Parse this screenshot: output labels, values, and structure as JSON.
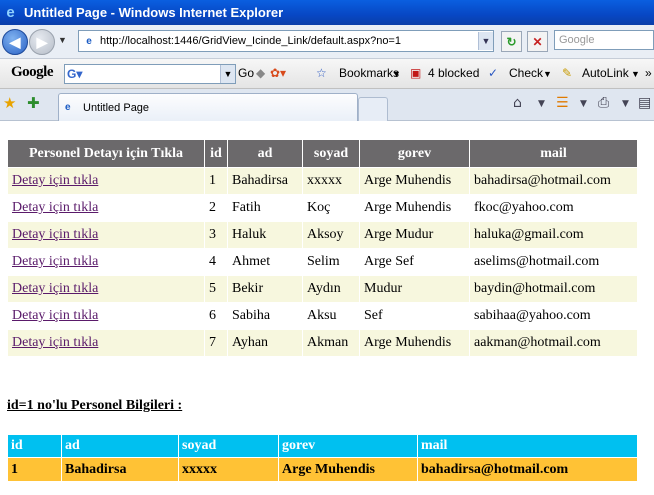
{
  "window": {
    "title": "Untitled Page - Windows Internet Explorer"
  },
  "address_bar": {
    "url": "http://localhost:1446/GridView_Icinde_Link/default.aspx?no=1"
  },
  "search_box": {
    "placeholder": "Google"
  },
  "google_toolbar": {
    "logo": "Google",
    "go_label": "Go",
    "bookmarks_label": "Bookmarks",
    "blocked_label": "4 blocked",
    "check_label": "Check",
    "autolink_label": "AutoLink"
  },
  "tab": {
    "title": "Untitled Page"
  },
  "grid1": {
    "headers": [
      "Personel Detayı için Tıkla",
      "id",
      "ad",
      "soyad",
      "gorev",
      "mail"
    ],
    "link_text": "Detay için tıkla",
    "rows": [
      {
        "id": "1",
        "ad": "Bahadirsa",
        "soyad": "xxxxx",
        "gorev": "Arge Muhendis",
        "mail": "bahadirsa@hotmail.com"
      },
      {
        "id": "2",
        "ad": "Fatih",
        "soyad": "Koç",
        "gorev": "Arge Muhendis",
        "mail": "fkoc@yahoo.com"
      },
      {
        "id": "3",
        "ad": "Haluk",
        "soyad": "Aksoy",
        "gorev": "Arge Mudur",
        "mail": "haluka@gmail.com"
      },
      {
        "id": "4",
        "ad": "Ahmet",
        "soyad": "Selim",
        "gorev": "Arge Sef",
        "mail": "aselims@hotmail.com"
      },
      {
        "id": "5",
        "ad": "Bekir",
        "soyad": "Aydın",
        "gorev": "Mudur",
        "mail": "baydin@hotmail.com"
      },
      {
        "id": "6",
        "ad": "Sabiha",
        "soyad": "Aksu",
        "gorev": "Sef",
        "mail": "sabihaa@yahoo.com"
      },
      {
        "id": "7",
        "ad": "Ayhan",
        "soyad": "Akman",
        "gorev": "Arge Muhendis",
        "mail": "aakman@hotmail.com"
      }
    ]
  },
  "detail": {
    "heading": "id=1 no'lu Personel Bilgileri :",
    "headers": [
      "id",
      "ad",
      "soyad",
      "gorev",
      "mail"
    ],
    "row": [
      "1",
      "Bahadirsa",
      "xxxxx",
      "Arge Muhendis",
      "bahadirsa@hotmail.com"
    ]
  },
  "colors": {
    "grid_header": "#6b696b",
    "grid_odd_row": "#f7f7de",
    "link": "#5a1a6a",
    "detail_header": "#00c0f0",
    "detail_row": "#ffc235"
  }
}
